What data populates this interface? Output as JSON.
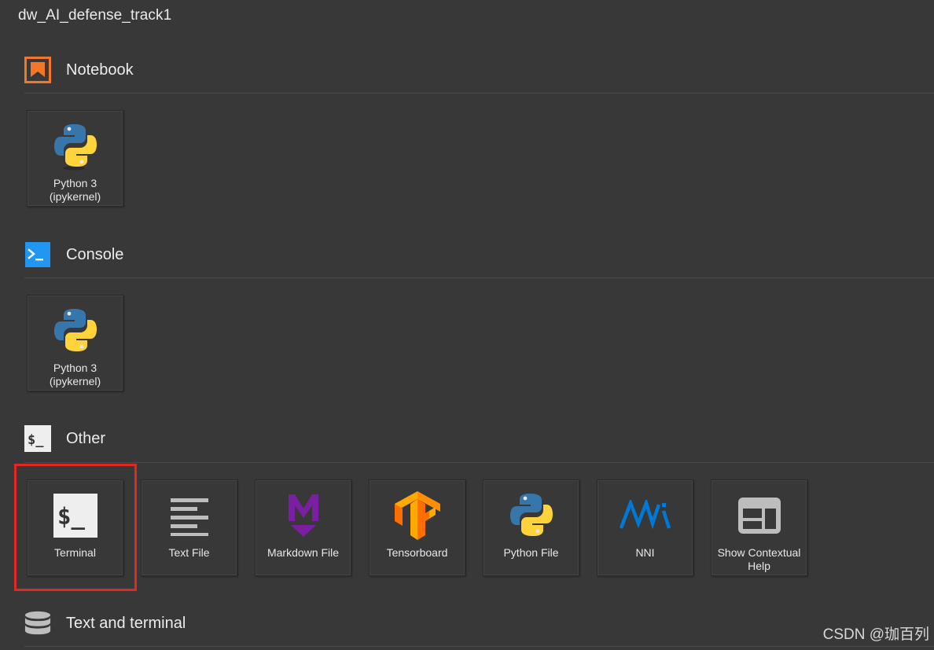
{
  "cwd_title": "dw_AI_defense_track1",
  "sections": {
    "notebook": {
      "title": "Notebook",
      "icon": "notebook-bookmark-icon",
      "accent": "#F37726",
      "cards": [
        {
          "label_line1": "Python 3",
          "label_line2": "(ipykernel)",
          "icon": "python-logo-icon"
        }
      ]
    },
    "console": {
      "title": "Console",
      "icon": "console-prompt-icon",
      "accent": "#2196F3",
      "cards": [
        {
          "label_line1": "Python 3",
          "label_line2": "(ipykernel)",
          "icon": "python-logo-icon"
        }
      ]
    },
    "other": {
      "title": "Other",
      "icon": "terminal-dollar-icon",
      "cards": [
        {
          "label": "Terminal",
          "icon": "terminal-icon",
          "highlighted": true
        },
        {
          "label": "Text File",
          "icon": "text-file-lines-icon"
        },
        {
          "label": "Markdown File",
          "icon": "markdown-m-icon"
        },
        {
          "label": "Tensorboard",
          "icon": "tensorflow-logo-icon"
        },
        {
          "label": "Python File",
          "icon": "python-logo-icon"
        },
        {
          "label": "NNI",
          "icon": "nni-logo-icon"
        },
        {
          "label_line1": "Show Contextual",
          "label_line2": "Help",
          "icon": "contextual-help-panel-icon"
        }
      ]
    },
    "text_and_terminal": {
      "title": "Text and terminal",
      "icon": "database-stack-icon"
    }
  },
  "highlight_color": "#E32722",
  "watermark": "CSDN @珈百列"
}
